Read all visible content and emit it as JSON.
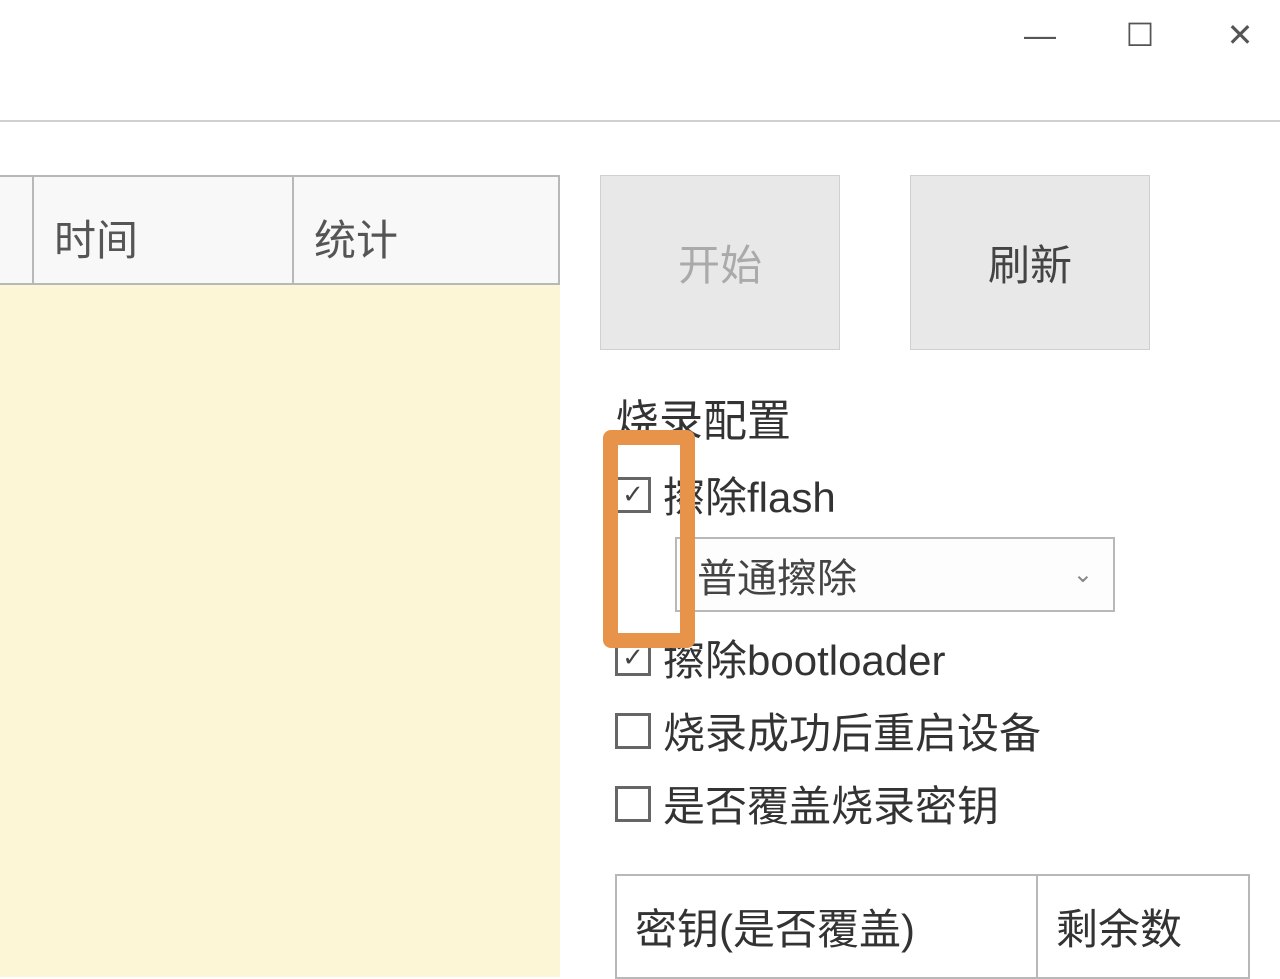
{
  "titlebar": {
    "minimize": "—",
    "maximize": "☐",
    "close": "✕"
  },
  "table": {
    "headers": {
      "time": "时间",
      "stat": "统计"
    }
  },
  "buttons": {
    "start": "开始",
    "refresh": "刷新"
  },
  "config": {
    "title": "烧录配置",
    "erase_flash": {
      "label": "擦除flash",
      "checked": true
    },
    "erase_mode": {
      "selected": "普通擦除"
    },
    "erase_bootloader": {
      "label": "擦除bootloader",
      "checked": true
    },
    "restart_after": {
      "label": "烧录成功后重启设备",
      "checked": false
    },
    "overwrite_key": {
      "label": "是否覆盖烧录密钥",
      "checked": false
    }
  },
  "key_table": {
    "left": "密钥(是否覆盖)",
    "right": "剩余数"
  }
}
